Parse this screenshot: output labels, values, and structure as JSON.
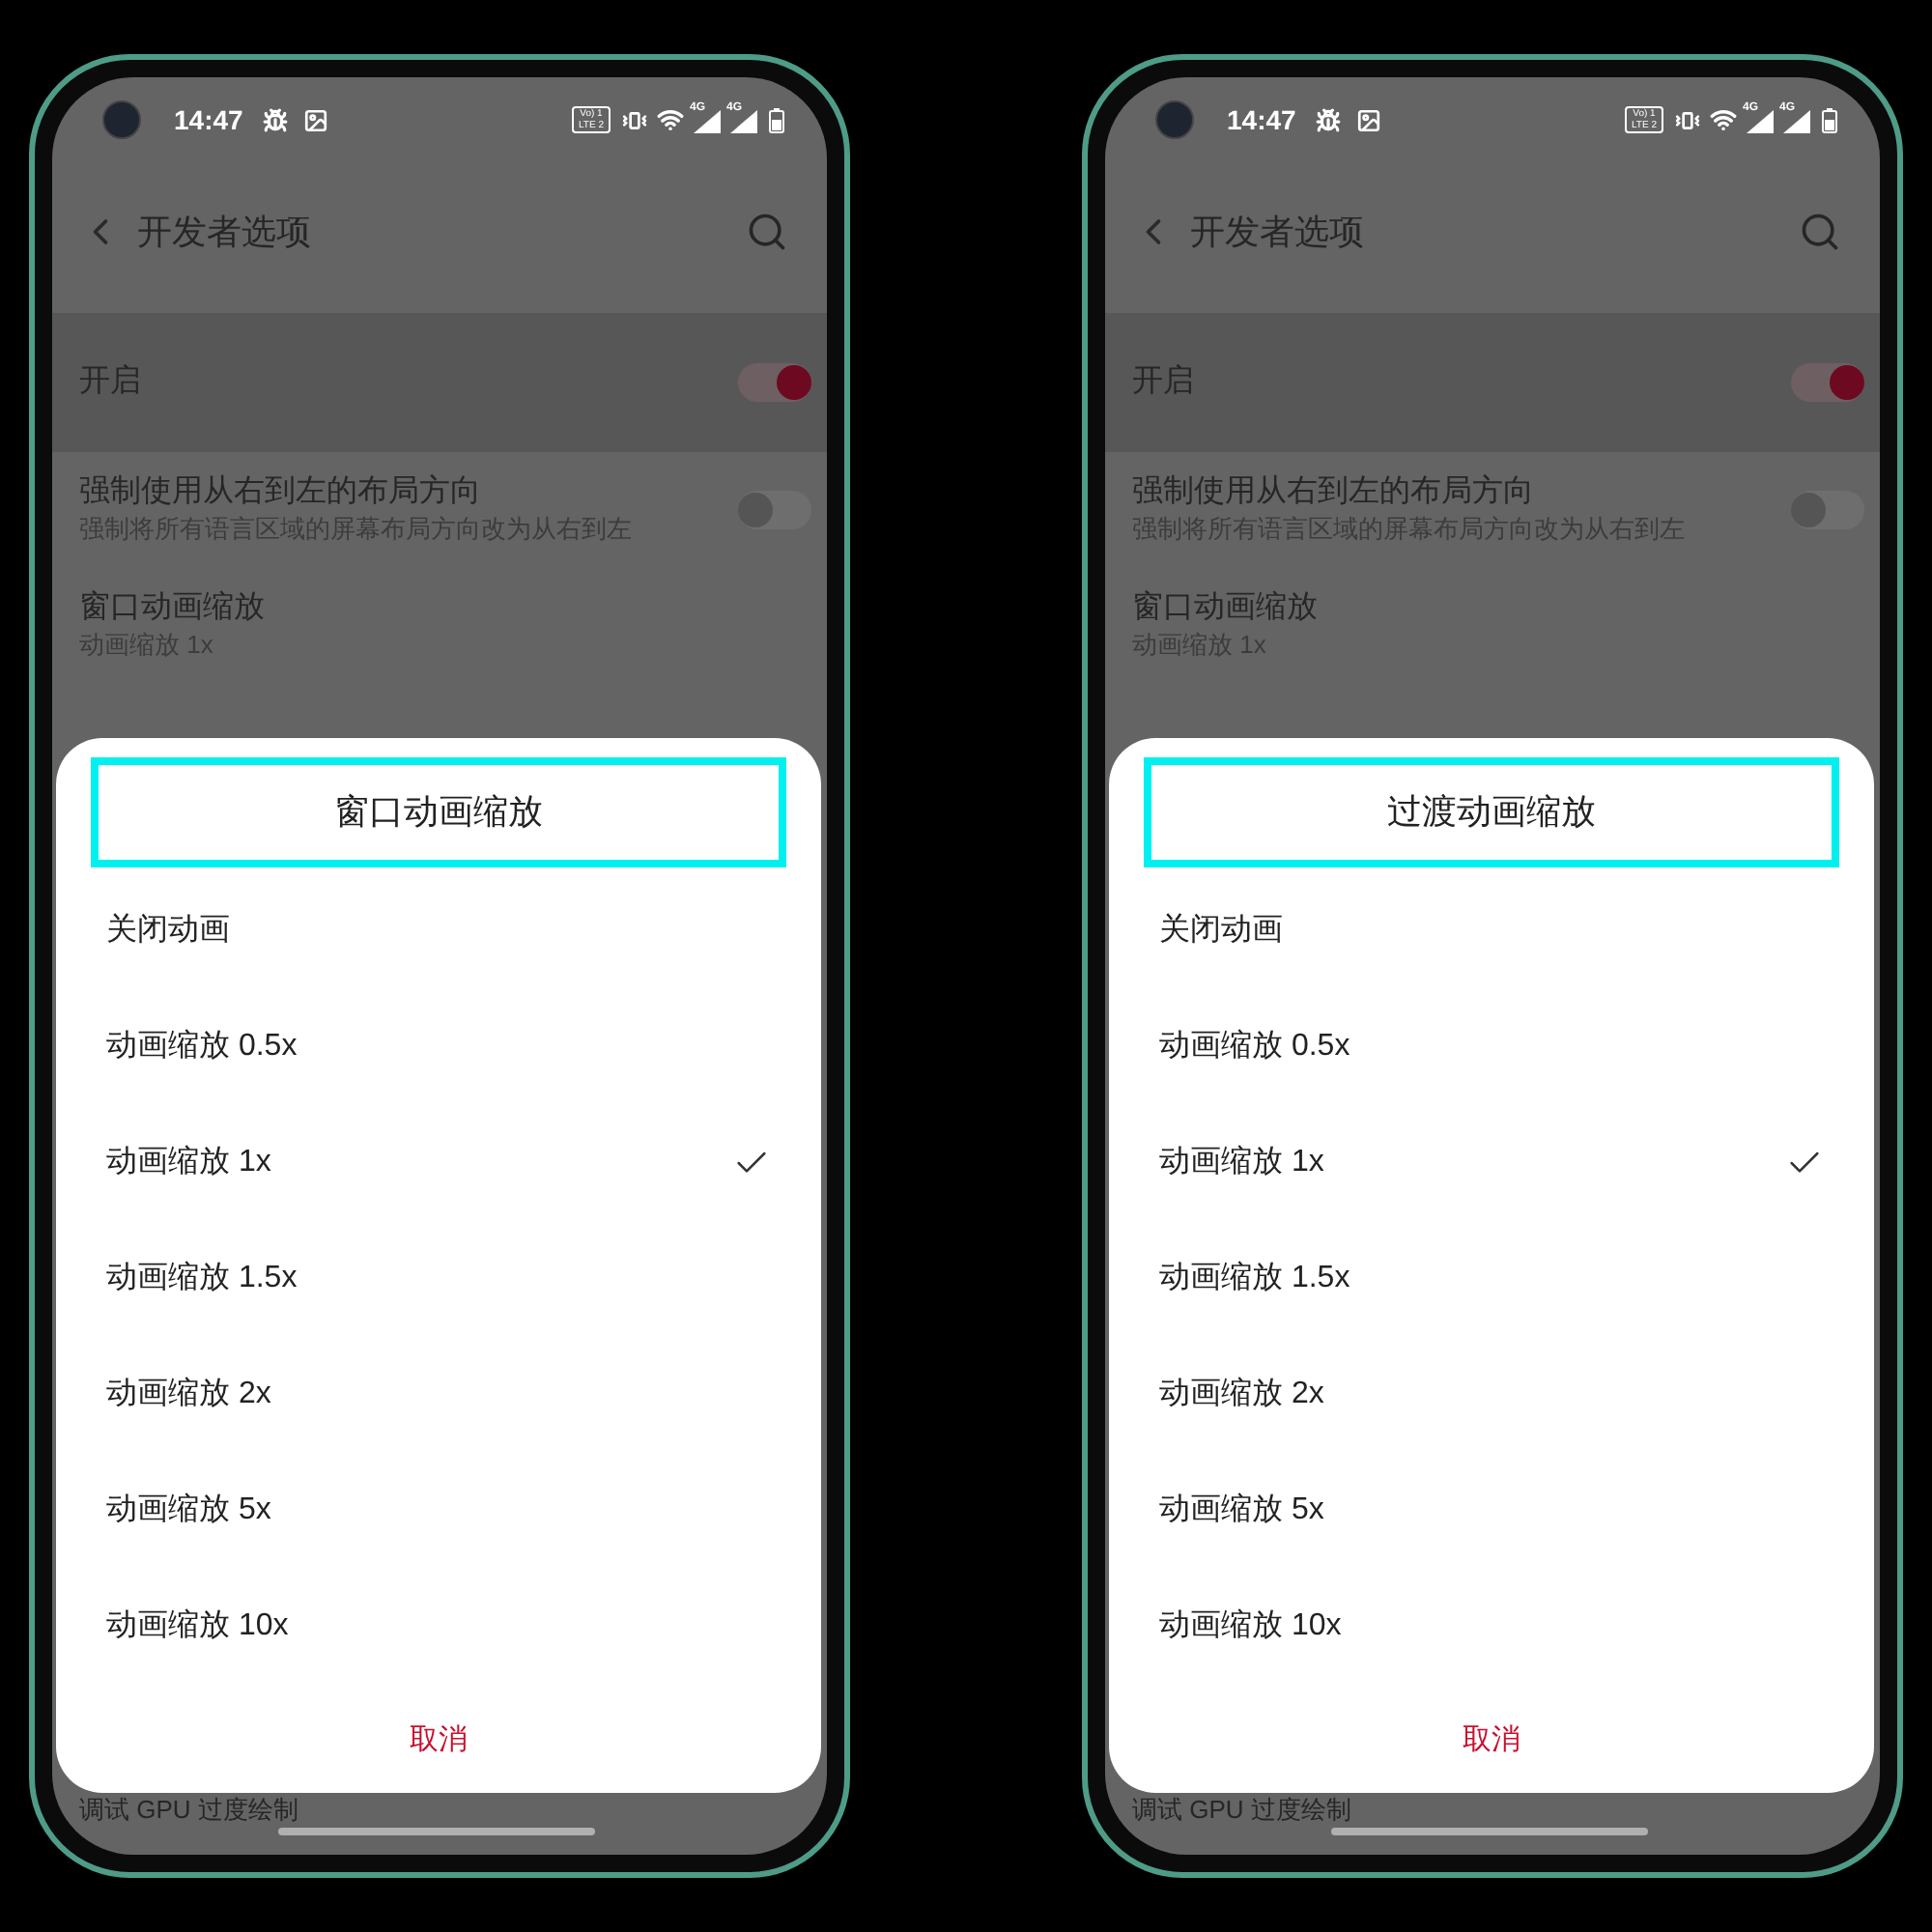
{
  "phones": [
    {
      "status_bar": {
        "time": "14:47",
        "volte": "Vo) 1 LTE 2",
        "network_1": "4G",
        "network_2": "4G"
      },
      "app_bar": {
        "title": "开发者选项"
      },
      "settings": [
        {
          "kind": "toggle",
          "title": "开启",
          "on": true,
          "selected": true
        },
        {
          "kind": "toggle",
          "title": "强制使用从右到左的布局方向",
          "subtitle": "强制将所有语言区域的屏幕布局方向改为从右到左",
          "on": false,
          "selected": false
        },
        {
          "kind": "value",
          "title": "窗口动画缩放",
          "subtitle": "动画缩放 1x",
          "selected": false
        }
      ],
      "dialog": {
        "title": "窗口动画缩放",
        "highlighted": true,
        "options": [
          {
            "label": "关闭动画",
            "selected": false
          },
          {
            "label": "动画缩放 0.5x",
            "selected": false
          },
          {
            "label": "动画缩放 1x",
            "selected": true
          },
          {
            "label": "动画缩放 1.5x",
            "selected": false
          },
          {
            "label": "动画缩放 2x",
            "selected": false
          },
          {
            "label": "动画缩放 5x",
            "selected": false
          },
          {
            "label": "动画缩放 10x",
            "selected": false
          }
        ],
        "cancel": "取消"
      },
      "below_dialog": "调试 GPU 过度绘制"
    },
    {
      "status_bar": {
        "time": "14:47",
        "volte": "Vo) 1 LTE 2",
        "network_1": "4G",
        "network_2": "4G"
      },
      "app_bar": {
        "title": "开发者选项"
      },
      "settings": [
        {
          "kind": "toggle",
          "title": "开启",
          "on": true,
          "selected": true
        },
        {
          "kind": "toggle",
          "title": "强制使用从右到左的布局方向",
          "subtitle": "强制将所有语言区域的屏幕布局方向改为从右到左",
          "on": false,
          "selected": false
        },
        {
          "kind": "value",
          "title": "窗口动画缩放",
          "subtitle": "动画缩放 1x",
          "selected": false
        }
      ],
      "dialog": {
        "title": "过渡动画缩放",
        "highlighted": true,
        "options": [
          {
            "label": "关闭动画",
            "selected": false
          },
          {
            "label": "动画缩放 0.5x",
            "selected": false
          },
          {
            "label": "动画缩放 1x",
            "selected": true
          },
          {
            "label": "动画缩放 1.5x",
            "selected": false
          },
          {
            "label": "动画缩放 2x",
            "selected": false
          },
          {
            "label": "动画缩放 5x",
            "selected": false
          },
          {
            "label": "动画缩放 10x",
            "selected": false
          }
        ],
        "cancel": "取消"
      },
      "below_dialog": "调试 GPU 过度绘制"
    }
  ]
}
